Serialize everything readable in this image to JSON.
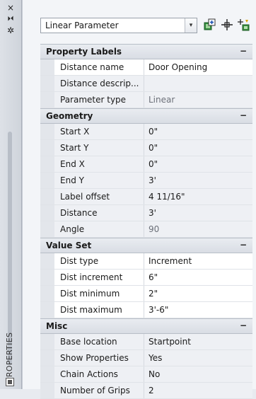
{
  "palette": {
    "strip": "#d6dae0",
    "panel": "#f3f5f8",
    "category": "#dde1e7",
    "row_highlight": "#ffffff",
    "row": "#eef0f4"
  },
  "strip": {
    "title": "PROPERTIES",
    "buttons": [
      "×",
      "⏵⏴",
      "✲"
    ]
  },
  "toolbar": {
    "object_type": "Linear Parameter",
    "dropdown_arrow": "▾",
    "icons": [
      "toggle-pickadd-icon",
      "select-objects-icon",
      "quick-select-icon"
    ]
  },
  "categories": [
    {
      "label": "Property Labels",
      "toggle": "−",
      "rows": [
        {
          "key": "Distance name",
          "value": "Door Opening",
          "highlight": true
        },
        {
          "key": "Distance descrip...",
          "value": "",
          "highlight": false
        },
        {
          "key": "Parameter type",
          "value": "Linear",
          "highlight": false,
          "dim": true
        }
      ]
    },
    {
      "label": "Geometry",
      "toggle": "−",
      "rows": [
        {
          "key": "Start X",
          "value": "0\"",
          "highlight": false
        },
        {
          "key": "Start Y",
          "value": "0\"",
          "highlight": false
        },
        {
          "key": "End X",
          "value": "0\"",
          "highlight": false
        },
        {
          "key": "End Y",
          "value": "3'",
          "highlight": false
        },
        {
          "key": "Label offset",
          "value": "4 11/16\"",
          "highlight": false
        },
        {
          "key": "Distance",
          "value": "3'",
          "highlight": false
        },
        {
          "key": "Angle",
          "value": "90",
          "highlight": false,
          "dim": true
        }
      ]
    },
    {
      "label": "Value Set",
      "toggle": "−",
      "rows": [
        {
          "key": "Dist type",
          "value": "Increment",
          "highlight": true
        },
        {
          "key": "Dist increment",
          "value": "6\"",
          "highlight": true
        },
        {
          "key": "Dist minimum",
          "value": "2\"",
          "highlight": true
        },
        {
          "key": "Dist maximum",
          "value": "3'-6\"",
          "highlight": true
        }
      ]
    },
    {
      "label": "Misc",
      "toggle": "−",
      "rows": [
        {
          "key": "Base location",
          "value": "Startpoint",
          "highlight": false
        },
        {
          "key": "Show Properties",
          "value": "Yes",
          "highlight": false
        },
        {
          "key": "Chain Actions",
          "value": "No",
          "highlight": false
        },
        {
          "key": "Number of Grips",
          "value": "2",
          "highlight": false
        }
      ]
    }
  ]
}
